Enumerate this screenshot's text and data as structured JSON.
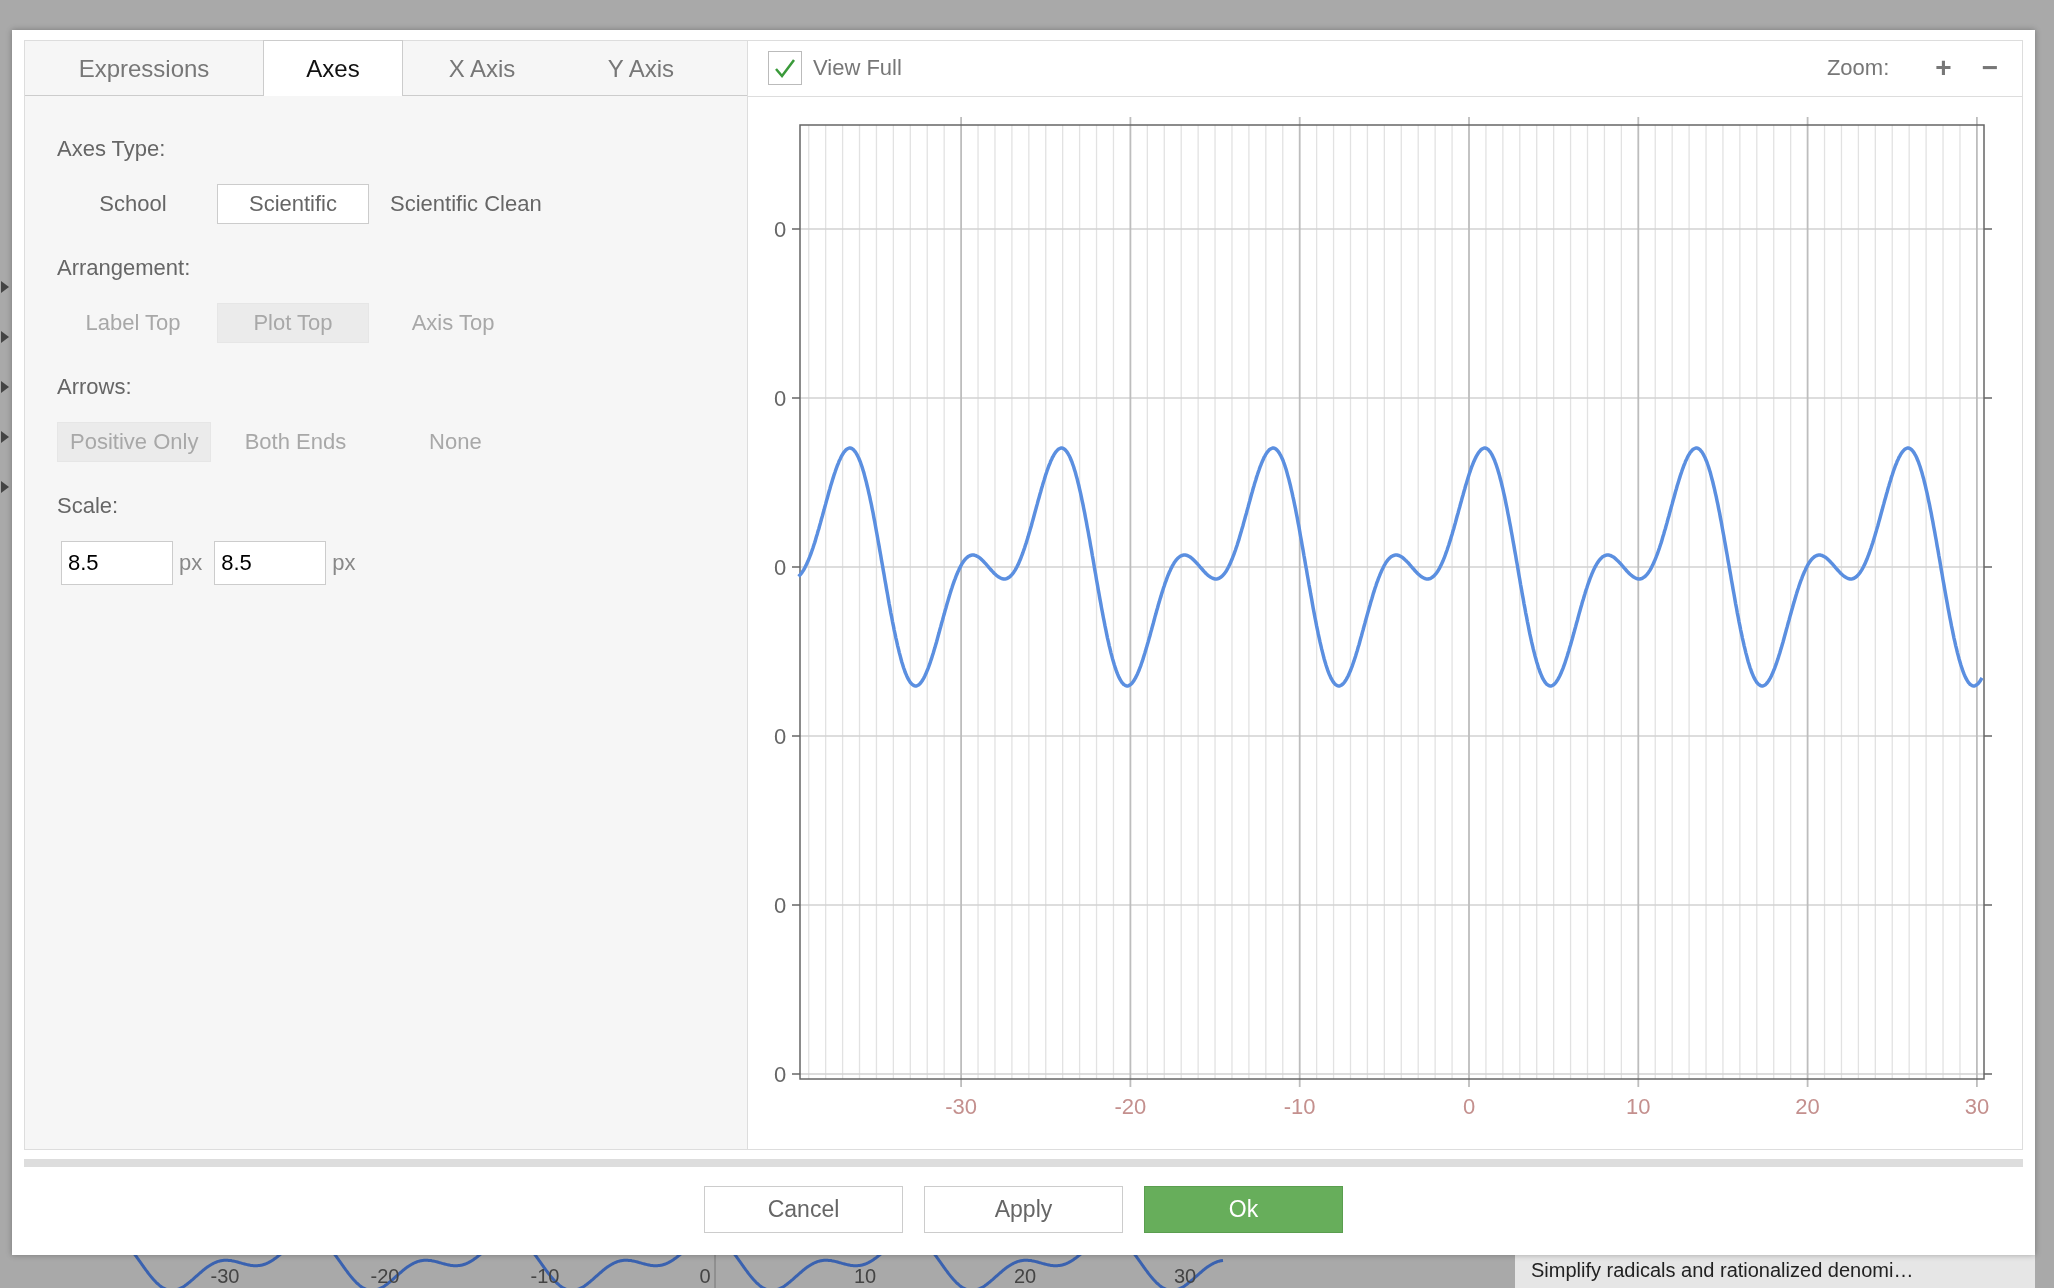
{
  "tabs": [
    {
      "label": "Expressions",
      "selected": false
    },
    {
      "label": "Axes",
      "selected": true
    },
    {
      "label": "X Axis",
      "selected": false
    },
    {
      "label": "Y Axis",
      "selected": false
    }
  ],
  "sections": [
    {
      "kind": "options",
      "label": "Axes Type:",
      "options": [
        {
          "label": "School",
          "selected": false,
          "disabled": false
        },
        {
          "label": "Scientific",
          "selected": true,
          "disabled": false
        },
        {
          "label": "Scientific Clean",
          "selected": false,
          "disabled": false
        }
      ]
    },
    {
      "kind": "options",
      "label": "Arrangement:",
      "options": [
        {
          "label": "Label Top",
          "selected": false,
          "disabled": true
        },
        {
          "label": "Plot Top",
          "selected": true,
          "disabled": true
        },
        {
          "label": "Axis Top",
          "selected": false,
          "disabled": true
        }
      ]
    },
    {
      "kind": "options",
      "label": "Arrows:",
      "options": [
        {
          "label": "Positive Only",
          "selected": true,
          "disabled": true
        },
        {
          "label": "Both Ends",
          "selected": false,
          "disabled": true
        },
        {
          "label": "None",
          "selected": false,
          "disabled": true
        }
      ]
    },
    {
      "kind": "scale",
      "label": "Scale:",
      "inputs": [
        {
          "value": "8.5",
          "unit": "px"
        },
        {
          "value": "8.5",
          "unit": "px"
        }
      ]
    }
  ],
  "view_full": {
    "label": "View Full",
    "checked": true
  },
  "zoom": {
    "label": "Zoom:",
    "buttons": [
      "+",
      "−"
    ]
  },
  "plot": {
    "y_labels": [
      "0",
      "0",
      "0",
      "0",
      "0",
      "0"
    ],
    "x_labels": [
      "-30",
      "-20",
      "-10",
      "0",
      "10",
      "20",
      "30"
    ]
  },
  "buttons": [
    {
      "label": "Cancel",
      "kind": "default"
    },
    {
      "label": "Apply",
      "kind": "default"
    },
    {
      "label": "Ok",
      "kind": "primary"
    }
  ],
  "background": {
    "plot_labels": [
      "-30",
      "-20",
      "-10",
      "0",
      "10",
      "20",
      "30"
    ],
    "status": "Simplify radicals and rationalized denomi…"
  }
}
